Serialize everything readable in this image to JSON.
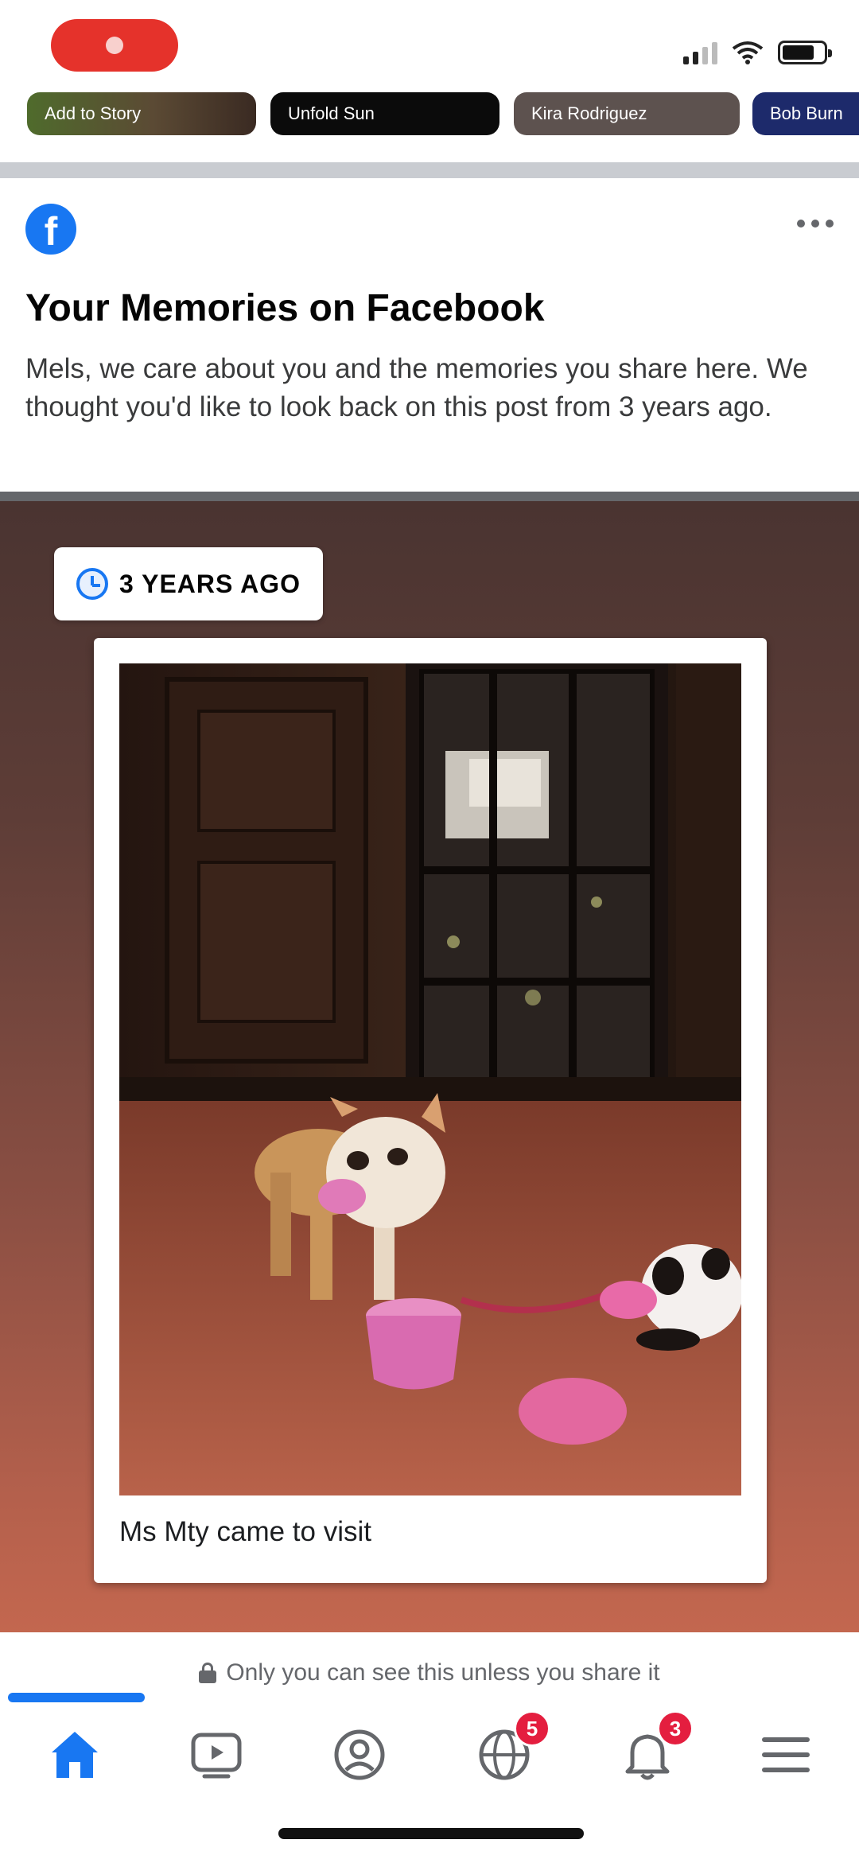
{
  "stories": [
    {
      "label": "Add to Story",
      "color": "#5b4a34"
    },
    {
      "label": "Unfold Sun",
      "color": "#0b0b0b"
    },
    {
      "label": "Kira Rodriguez",
      "color": "#5d524f"
    },
    {
      "label": "Bob Burn",
      "color": "#1d2a6b"
    }
  ],
  "memories": {
    "title": "Your Memories on Facebook",
    "description": "Mels, we care about you and the memories you share here. We thought you'd like to look back on this post from 3 years ago."
  },
  "card": {
    "badge_label": "3 YEARS AGO",
    "caption": "Ms Mty came to visit"
  },
  "privacy_note": "Only you can see this unless you share it",
  "tabs": {
    "notifications_badge": "5",
    "messages_badge": "3"
  },
  "colors": {
    "brand": "#1877f2",
    "record": "#e5322b",
    "badge": "#e41e3f"
  }
}
